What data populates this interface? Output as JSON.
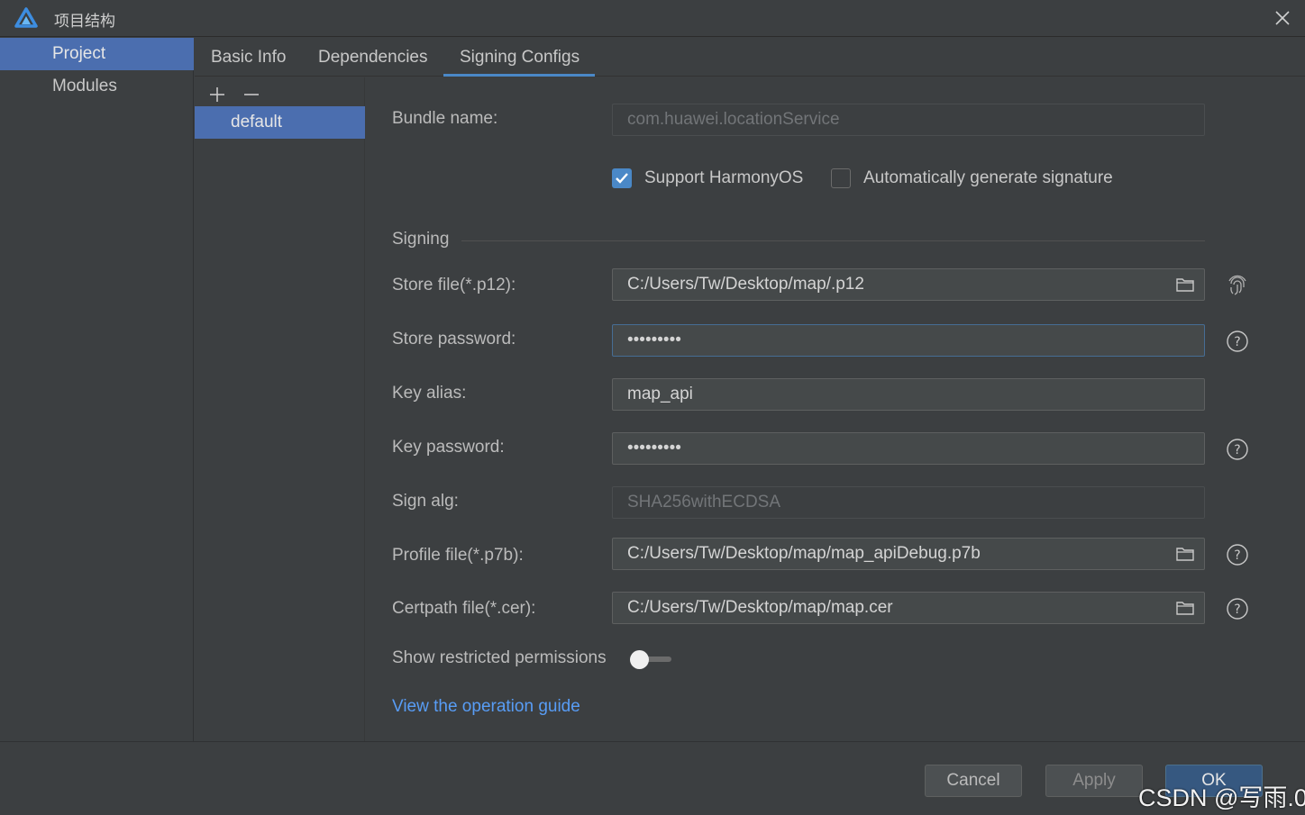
{
  "window": {
    "title": "项目结构",
    "logo_icon": "harmony-logo-icon",
    "close_icon": "close-icon"
  },
  "nav": {
    "items": [
      {
        "label": "Project",
        "active": true
      },
      {
        "label": "Modules",
        "active": false
      }
    ]
  },
  "tabs": [
    {
      "label": "Basic Info",
      "active": false
    },
    {
      "label": "Dependencies",
      "active": false
    },
    {
      "label": "Signing Configs",
      "active": true
    }
  ],
  "configs": {
    "add_icon": "plus-icon",
    "remove_icon": "minus-icon",
    "items": [
      {
        "label": "default",
        "selected": true
      }
    ]
  },
  "form": {
    "bundle_name": {
      "label": "Bundle name:",
      "value": "com.huawei.locationService",
      "disabled": true
    },
    "support_harmony": {
      "label": "Support HarmonyOS",
      "checked": true
    },
    "auto_sign": {
      "label": "Automatically generate signature",
      "checked": false
    },
    "section_signing": "Signing",
    "store_file": {
      "label": "Store file(*.p12):",
      "value": "C:/Users/Tw/Desktop/map/.p12"
    },
    "store_password": {
      "label": "Store password:",
      "value": "•••••••••"
    },
    "key_alias": {
      "label": "Key alias:",
      "value": "map_api"
    },
    "key_password": {
      "label": "Key password:",
      "value": "•••••••••"
    },
    "sign_alg": {
      "label": "Sign alg:",
      "value": "SHA256withECDSA",
      "disabled": true
    },
    "profile_file": {
      "label": "Profile file(*.p7b):",
      "value": "C:/Users/Tw/Desktop/map/map_apiDebug.p7b"
    },
    "certpath_file": {
      "label": "Certpath file(*.cer):",
      "value": "C:/Users/Tw/Desktop/map/map.cer"
    },
    "show_restricted": {
      "label": "Show restricted permissions",
      "on": false
    },
    "guide_link": "View the operation guide"
  },
  "footer": {
    "cancel": "Cancel",
    "apply": "Apply",
    "ok": "OK",
    "watermark": "CSDN @写雨.0"
  },
  "colors": {
    "background": "#3c3f41",
    "selection": "#4b6eaf",
    "accent": "#4a88c7",
    "link": "#589df6"
  }
}
